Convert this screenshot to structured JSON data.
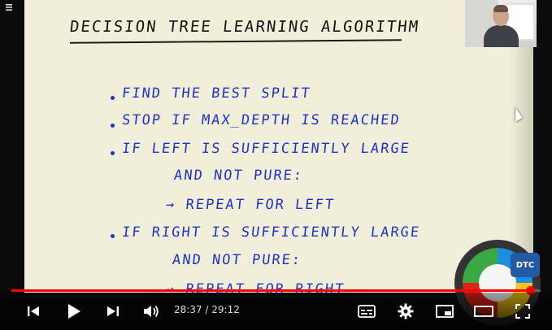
{
  "video": {
    "title": "DECISION TREE LEARNING ALGORITHM",
    "lines": [
      "FIND THE BEST SPLIT",
      "STOP IF MAX_DEPTH IS REACHED",
      "IF LEFT IS SUFFICIENTLY LARGE",
      "AND NOT PURE:",
      "→ REPEAT FOR LEFT",
      "IF RIGHT IS SUFFICIENTLY LARGE",
      "AND NOT PURE:",
      "→ REPEAT FOR RIGHT"
    ],
    "ink_color": "#1f33c8",
    "badge": "DTC"
  },
  "player": {
    "current_time": "28:37",
    "separator": " / ",
    "duration": "29:12",
    "progress": 0.98,
    "accent": "#ff0000",
    "icons": {
      "menu": "menu-icon",
      "previous": "previous-icon",
      "play": "play-icon",
      "next": "next-icon",
      "volume": "volume-icon",
      "subtitles": "subtitles-icon",
      "settings": "gear-icon",
      "miniplayer": "miniplayer-icon",
      "theater": "theater-icon",
      "fullscreen": "fullscreen-icon"
    }
  }
}
